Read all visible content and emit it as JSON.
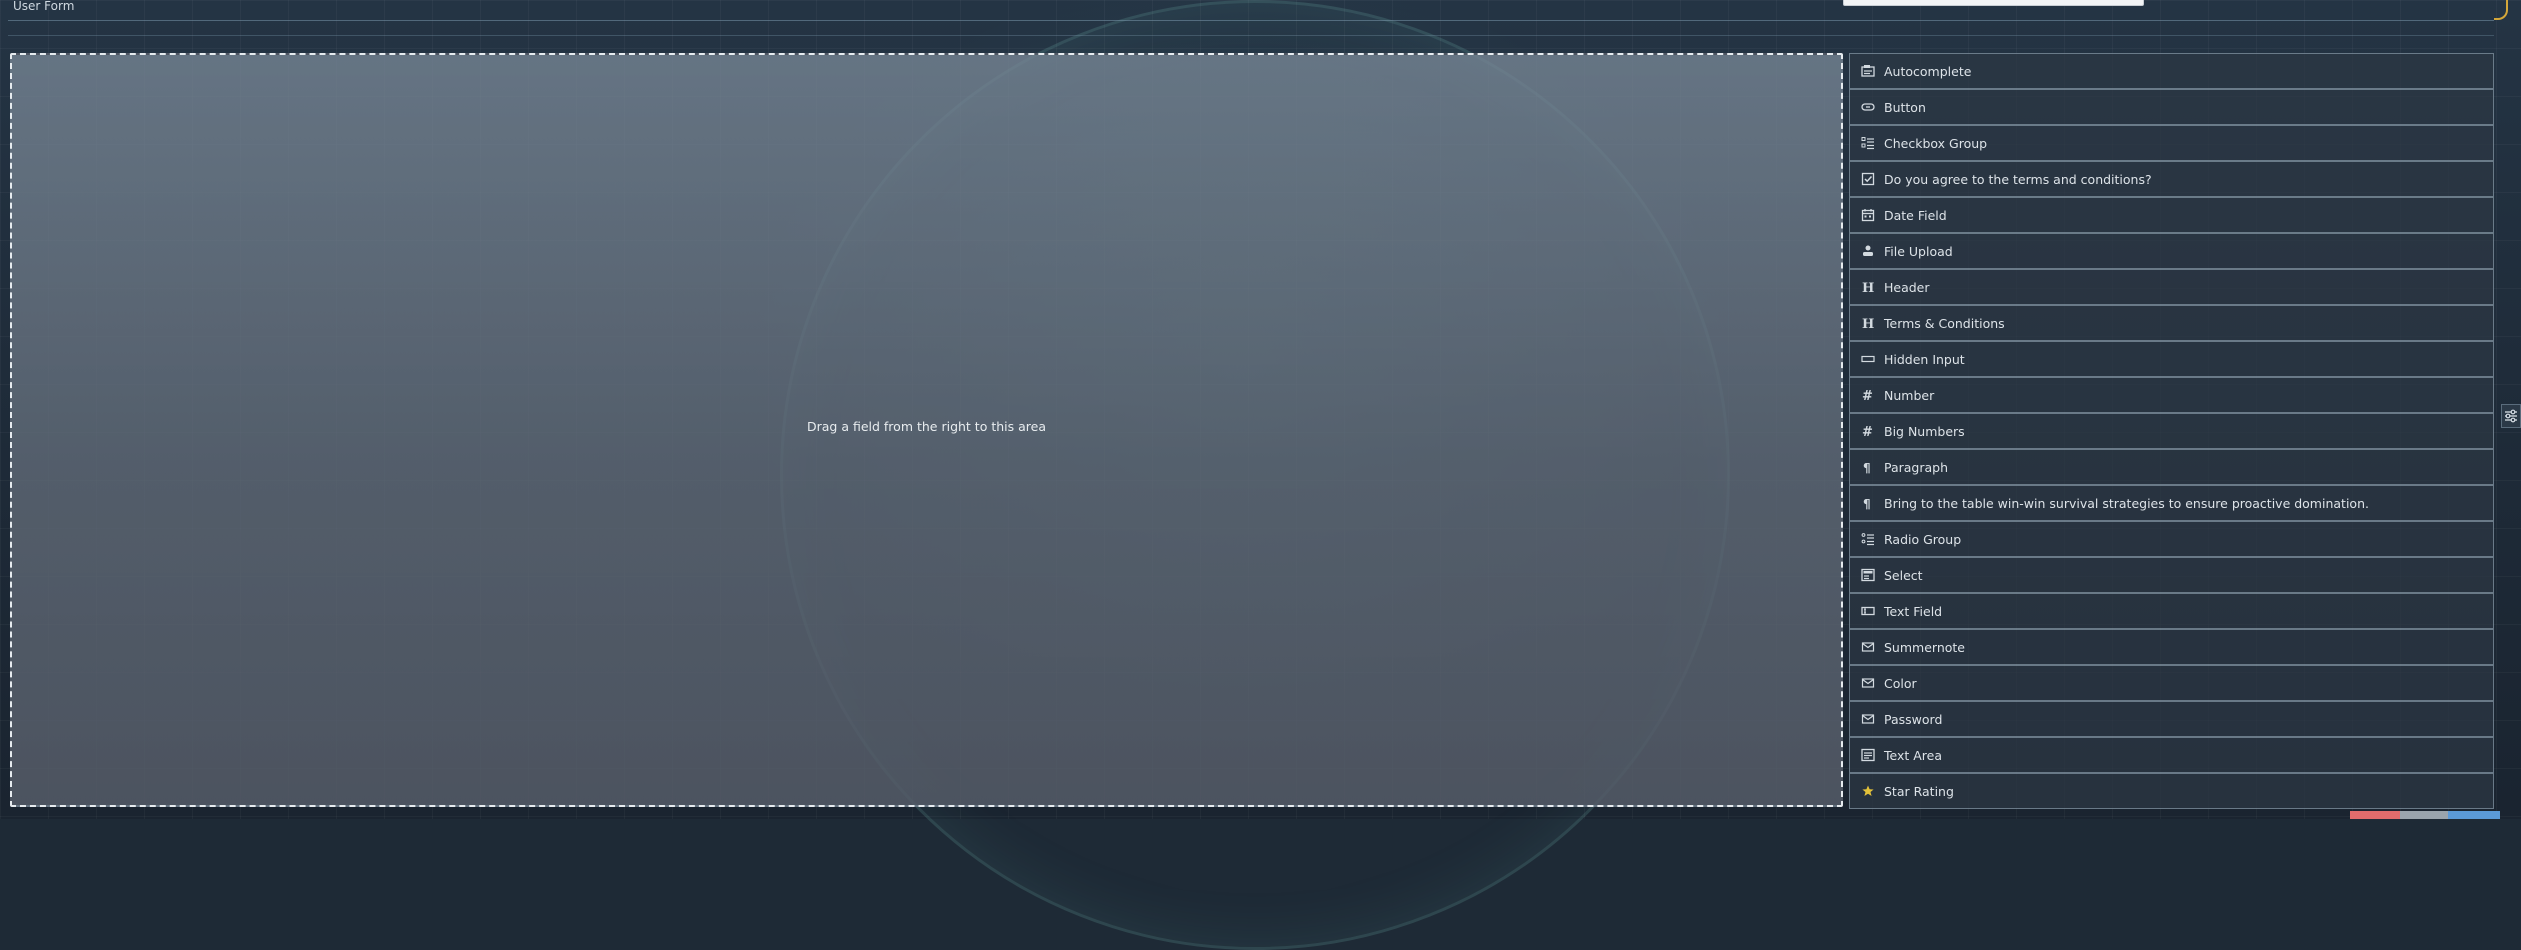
{
  "header": {
    "form_title": "User Form"
  },
  "dropzone": {
    "message": "Drag a field from the right to this area"
  },
  "palette": {
    "items": [
      {
        "label": "Autocomplete",
        "icon": "autocomplete-icon"
      },
      {
        "label": "Button",
        "icon": "button-icon"
      },
      {
        "label": "Checkbox Group",
        "icon": "checkbox-group-icon"
      },
      {
        "label": "Do you agree to the terms and conditions?",
        "icon": "checkbox-icon"
      },
      {
        "label": "Date Field",
        "icon": "calendar-icon"
      },
      {
        "label": "File Upload",
        "icon": "upload-icon"
      },
      {
        "label": "Header",
        "icon": "heading-icon"
      },
      {
        "label": "Terms & Conditions",
        "icon": "heading-icon"
      },
      {
        "label": "Hidden Input",
        "icon": "hidden-input-icon"
      },
      {
        "label": "Number",
        "icon": "hash-icon"
      },
      {
        "label": "Big Numbers",
        "icon": "hash-icon"
      },
      {
        "label": "Paragraph",
        "icon": "paragraph-icon"
      },
      {
        "label": "Bring to the table win-win survival strategies to ensure proactive domination.",
        "icon": "paragraph-icon"
      },
      {
        "label": "Radio Group",
        "icon": "radio-group-icon"
      },
      {
        "label": "Select",
        "icon": "select-icon"
      },
      {
        "label": "Text Field",
        "icon": "text-field-icon"
      },
      {
        "label": "Summernote",
        "icon": "envelope-icon"
      },
      {
        "label": "Color",
        "icon": "envelope-icon"
      },
      {
        "label": "Password",
        "icon": "envelope-icon"
      },
      {
        "label": "Text Area",
        "icon": "text-area-icon"
      },
      {
        "label": "Star Rating",
        "icon": "star-icon"
      }
    ]
  },
  "colors": {
    "accent_star": "#e2c13a",
    "btn_red": "#e06c6c",
    "btn_grey": "#9aa4ad",
    "btn_blue": "#5b9ad8"
  }
}
